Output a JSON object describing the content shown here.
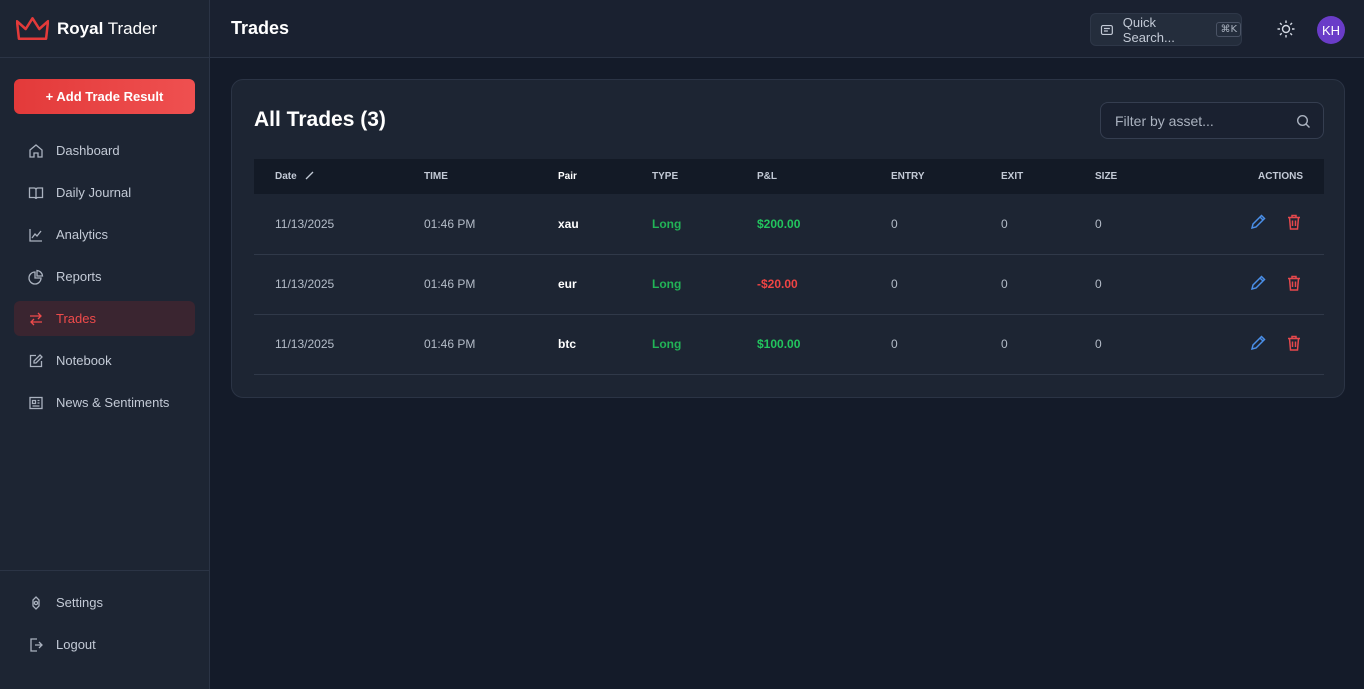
{
  "brand": {
    "bold": "Royal",
    "light": "Trader"
  },
  "sidebar": {
    "add_button": "+ Add Trade Result",
    "items": [
      {
        "label": "Dashboard",
        "icon": "home-icon"
      },
      {
        "label": "Daily Journal",
        "icon": "book-icon"
      },
      {
        "label": "Analytics",
        "icon": "chart-icon"
      },
      {
        "label": "Reports",
        "icon": "pie-icon"
      },
      {
        "label": "Trades",
        "icon": "swap-icon",
        "active": true
      },
      {
        "label": "Notebook",
        "icon": "edit-icon"
      },
      {
        "label": "News & Sentiments",
        "icon": "newspaper-icon"
      }
    ],
    "bottom": [
      {
        "label": "Settings",
        "icon": "settings-icon"
      },
      {
        "label": "Logout",
        "icon": "logout-icon"
      }
    ]
  },
  "header": {
    "title": "Trades",
    "quick_search": "Quick Search...",
    "shortcut": "⌘K",
    "avatar_initials": "KH"
  },
  "main": {
    "card_title": "All Trades (3)",
    "filter_placeholder": "Filter by asset...",
    "columns": [
      "Date",
      "TIME",
      "Pair",
      "TYPE",
      "P&L",
      "ENTRY",
      "EXIT",
      "SIZE",
      "ACTIONS"
    ],
    "rows": [
      {
        "date": "11/13/2025",
        "time": "01:46 PM",
        "pair": "xau",
        "type": "Long",
        "pnl": "$200.00",
        "pnl_sign": "pos",
        "entry": "0",
        "exit": "0",
        "size": "0"
      },
      {
        "date": "11/13/2025",
        "time": "01:46 PM",
        "pair": "eur",
        "type": "Long",
        "pnl": "-$20.00",
        "pnl_sign": "neg",
        "entry": "0",
        "exit": "0",
        "size": "0"
      },
      {
        "date": "11/13/2025",
        "time": "01:46 PM",
        "pair": "btc",
        "type": "Long",
        "pnl": "$100.00",
        "pnl_sign": "pos",
        "entry": "0",
        "exit": "0",
        "size": "0"
      }
    ]
  },
  "colors": {
    "accent": "#ef4444",
    "positive": "#22c55e",
    "edit_icon": "#4a8fe8",
    "avatar": "#6a3cc8"
  }
}
